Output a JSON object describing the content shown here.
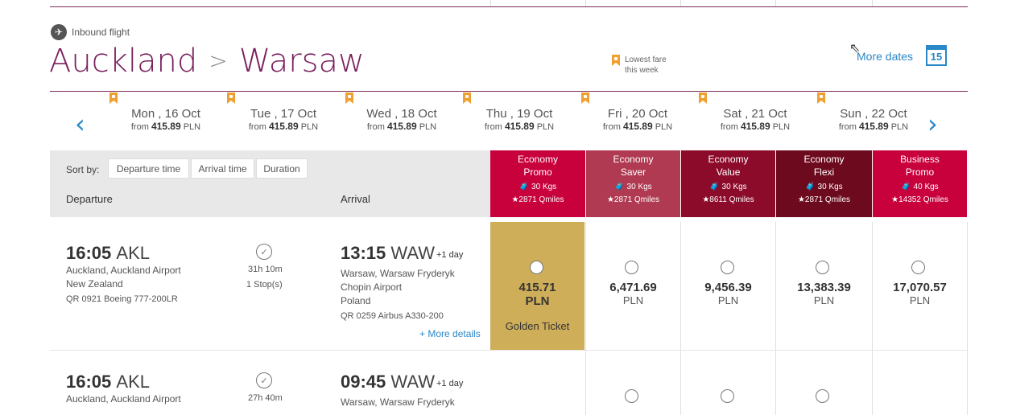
{
  "header": {
    "inbound_label": "Inbound flight",
    "origin": "Auckland",
    "separator": ">",
    "destination": "Warsaw",
    "legend_label": "Lowest fare this week",
    "more_dates": "More dates",
    "calendar_day": "15"
  },
  "dates": [
    {
      "day": "Mon , 16 Oct",
      "from": "from",
      "price": "415.89",
      "cur": "PLN"
    },
    {
      "day": "Tue , 17 Oct",
      "from": "from",
      "price": "415.89",
      "cur": "PLN"
    },
    {
      "day": "Wed , 18 Oct",
      "from": "from",
      "price": "415.89",
      "cur": "PLN"
    },
    {
      "day": "Thu , 19 Oct",
      "from": "from",
      "price": "415.89",
      "cur": "PLN"
    },
    {
      "day": "Fri , 20 Oct",
      "from": "from",
      "price": "415.89",
      "cur": "PLN"
    },
    {
      "day": "Sat , 21 Oct",
      "from": "from",
      "price": "415.89",
      "cur": "PLN"
    },
    {
      "day": "Sun , 22 Oct",
      "from": "from",
      "price": "415.89",
      "cur": "PLN"
    }
  ],
  "sort": {
    "label": "Sort by:",
    "options": [
      "Departure time",
      "Arrival time",
      "Duration"
    ]
  },
  "columns": {
    "departure": "Departure",
    "arrival": "Arrival"
  },
  "fares": [
    {
      "l1": "Economy",
      "l2": "Promo",
      "bag": "30 Kgs",
      "miles": "2871 Qmiles",
      "color": "#c8003c"
    },
    {
      "l1": "Economy",
      "l2": "Saver",
      "bag": "30 Kgs",
      "miles": "2871 Qmiles",
      "color": "#b03a52"
    },
    {
      "l1": "Economy",
      "l2": "Value",
      "bag": "30 Kgs",
      "miles": "8611 Qmiles",
      "color": "#8c0a2a"
    },
    {
      "l1": "Economy",
      "l2": "Flexi",
      "bag": "30 Kgs",
      "miles": "2871 Qmiles",
      "color": "#6e0a1e"
    },
    {
      "l1": "Business",
      "l2": "Promo",
      "bag": "40 Kgs",
      "miles": "14352 Qmiles",
      "color": "#c8003c"
    }
  ],
  "flights": [
    {
      "dep_time": "16:05",
      "dep_code": "AKL",
      "dep_city": "Auckland, Auckland Airport",
      "dep_country": "New Zealand",
      "dep_flight": "QR 0921 Boeing 777-200LR",
      "duration": "31h 10m",
      "stops": "1 Stop(s)",
      "arr_time": "13:15",
      "arr_code": "WAW",
      "arr_plus": "+1 day",
      "arr_city": "Warsaw, Warsaw Fryderyk",
      "arr_airport": "Chopin Airport",
      "arr_country": "Poland",
      "arr_flight": "QR 0259 Airbus A330-200",
      "more": "+ More details",
      "prices": [
        "415.71",
        "6,471.69",
        "9,456.39",
        "13,383.39",
        "17,070.57"
      ],
      "cur": "PLN",
      "golden": "Golden Ticket"
    },
    {
      "dep_time": "16:05",
      "dep_code": "AKL",
      "dep_city": "Auckland, Auckland Airport",
      "duration": "27h 40m",
      "arr_time": "09:45",
      "arr_code": "WAW",
      "arr_plus": "+1 day",
      "arr_city": "Warsaw, Warsaw Fryderyk"
    }
  ]
}
